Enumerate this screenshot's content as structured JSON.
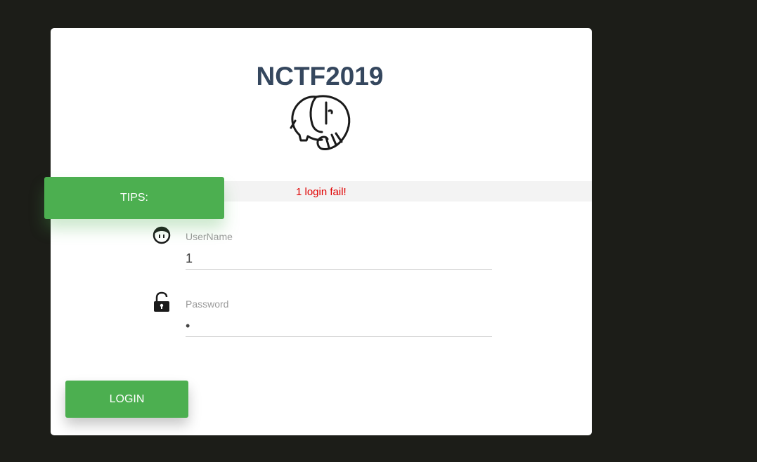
{
  "header": {
    "title": "NCTF2019",
    "logo_icon": "elephant-icon"
  },
  "tips": {
    "button_label": "TIPS:",
    "message": "1 login fail!",
    "message_color": "#e00000"
  },
  "form": {
    "username": {
      "icon": "user-face-icon",
      "label": "UserName",
      "value": "1"
    },
    "password": {
      "icon": "unlocked-padlock-icon",
      "label": "Password",
      "value": "1"
    }
  },
  "actions": {
    "login_label": "LOGIN"
  },
  "colors": {
    "accent": "#4caf50",
    "background": "#1c1d18",
    "title": "#35475e"
  }
}
